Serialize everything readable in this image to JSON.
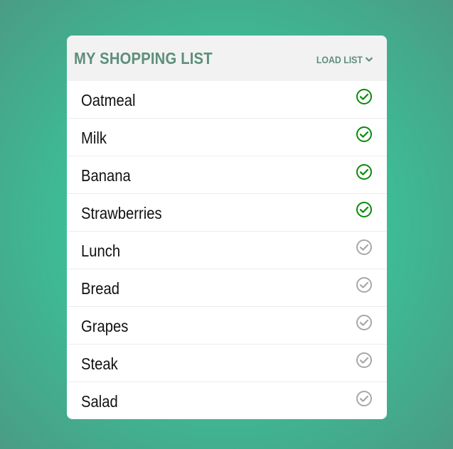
{
  "header": {
    "title": "MY SHOPPING LIST",
    "load_list_label": "LOAD LIST"
  },
  "colors": {
    "checked": "#0a8a0a",
    "unchecked": "#a8a8a8",
    "header_text": "#5d8f7b"
  },
  "items": [
    {
      "label": "Oatmeal",
      "checked": true
    },
    {
      "label": "Milk",
      "checked": true
    },
    {
      "label": "Banana",
      "checked": true
    },
    {
      "label": "Strawberries",
      "checked": true
    },
    {
      "label": "Lunch",
      "checked": false
    },
    {
      "label": "Bread",
      "checked": false
    },
    {
      "label": "Grapes",
      "checked": false
    },
    {
      "label": "Steak",
      "checked": false
    },
    {
      "label": "Salad",
      "checked": false
    }
  ],
  "icons": {
    "item_status": "check-circle-icon",
    "dropdown": "chevron-down-icon"
  }
}
